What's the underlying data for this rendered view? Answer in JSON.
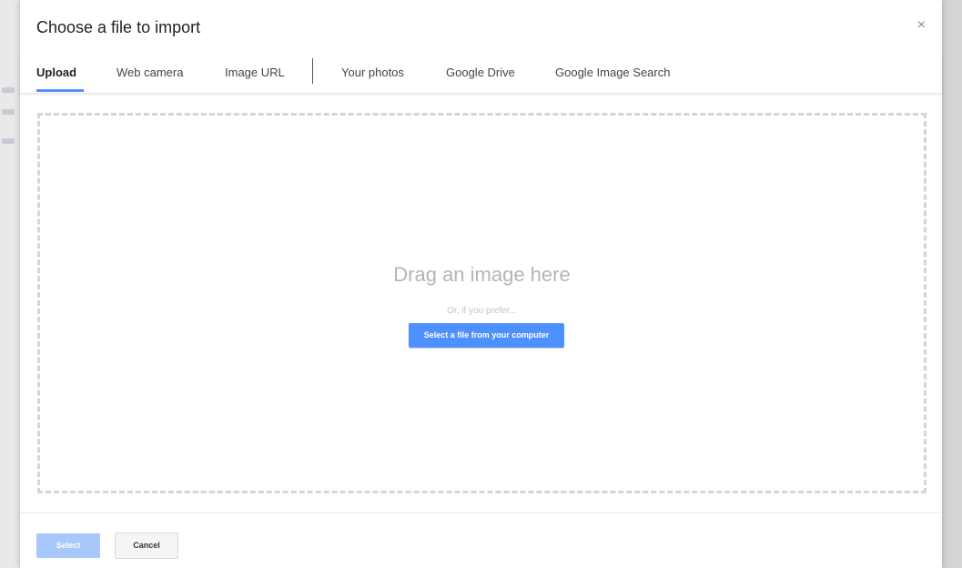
{
  "dialog": {
    "title": "Choose a file to import",
    "close_symbol": "×"
  },
  "tabs": [
    {
      "label": "Upload",
      "active": true
    },
    {
      "label": "Web camera",
      "active": false
    },
    {
      "label": "Image URL",
      "active": false
    },
    {
      "label": "Your photos",
      "active": false
    },
    {
      "label": "Google Drive",
      "active": false
    },
    {
      "label": "Google Image Search",
      "active": false
    }
  ],
  "dropzone": {
    "heading": "Drag an image here",
    "subtext": "Or, if you prefer...",
    "select_file_label": "Select a file from your computer"
  },
  "footer": {
    "select_label": "Select",
    "cancel_label": "Cancel"
  },
  "colors": {
    "accent": "#4d90fe",
    "accent_disabled": "#a8c7fa"
  },
  "icons": {
    "close": "close-icon"
  }
}
